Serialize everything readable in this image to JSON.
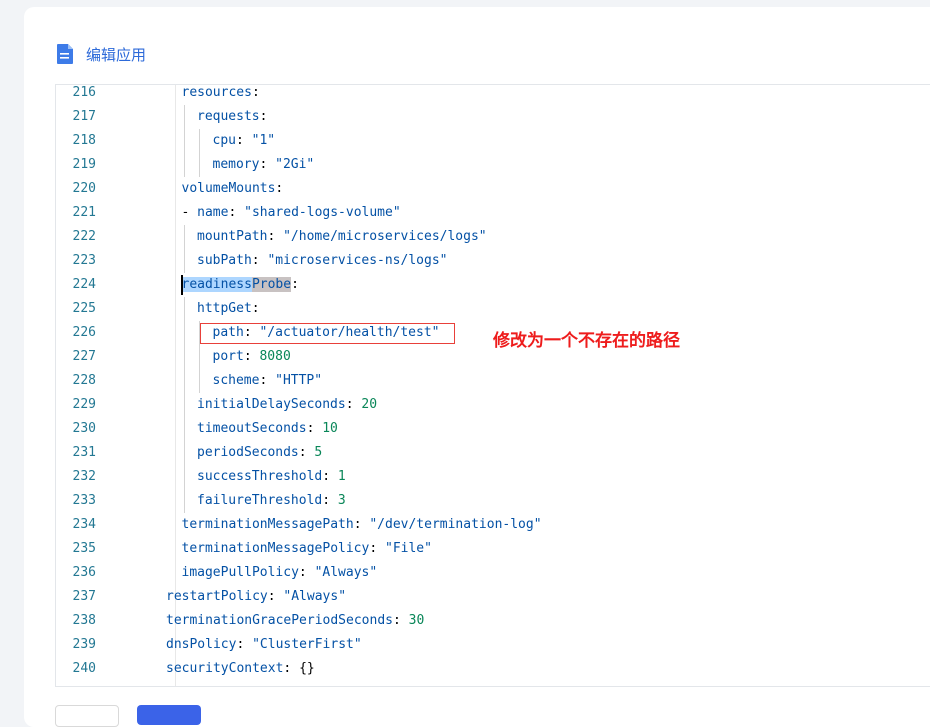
{
  "header": {
    "title": "编辑应用",
    "icon": "document-icon"
  },
  "annotation": {
    "text": "修改为一个不存在的路径",
    "color": "#ee1c1c"
  },
  "lines": [
    {
      "num": "216",
      "indent": 1,
      "parts": [
        {
          "t": "resources",
          "c": "k"
        },
        {
          "t": ":",
          "c": "p"
        }
      ]
    },
    {
      "num": "217",
      "indent": 2,
      "parts": [
        {
          "t": "requests",
          "c": "k"
        },
        {
          "t": ":",
          "c": "p"
        }
      ]
    },
    {
      "num": "218",
      "indent": 3,
      "parts": [
        {
          "t": "cpu",
          "c": "k"
        },
        {
          "t": ": ",
          "c": "p"
        },
        {
          "t": "\"1\"",
          "c": "s2"
        }
      ]
    },
    {
      "num": "219",
      "indent": 3,
      "parts": [
        {
          "t": "memory",
          "c": "k"
        },
        {
          "t": ": ",
          "c": "p"
        },
        {
          "t": "\"2Gi\"",
          "c": "s2"
        }
      ]
    },
    {
      "num": "220",
      "indent": 1,
      "parts": [
        {
          "t": "volumeMounts",
          "c": "k"
        },
        {
          "t": ":",
          "c": "p"
        }
      ]
    },
    {
      "num": "221",
      "indent": 1,
      "parts": [
        {
          "t": "- ",
          "c": "p"
        },
        {
          "t": "name",
          "c": "k"
        },
        {
          "t": ": ",
          "c": "p"
        },
        {
          "t": "\"shared-logs-volume\"",
          "c": "s2"
        }
      ]
    },
    {
      "num": "222",
      "indent": 2,
      "parts": [
        {
          "t": "mountPath",
          "c": "k"
        },
        {
          "t": ": ",
          "c": "p"
        },
        {
          "t": "\"/home/microservices/logs\"",
          "c": "s2"
        }
      ]
    },
    {
      "num": "223",
      "indent": 2,
      "parts": [
        {
          "t": "subPath",
          "c": "k"
        },
        {
          "t": ": ",
          "c": "p"
        },
        {
          "t": "\"microservices-ns/logs\"",
          "c": "s2"
        }
      ]
    },
    {
      "num": "224",
      "indent": 1,
      "parts": [
        {
          "t": "readiness",
          "c": "k sel1"
        },
        {
          "t": "Probe",
          "c": "k sel2"
        },
        {
          "t": ":",
          "c": "p"
        }
      ]
    },
    {
      "num": "225",
      "indent": 2,
      "parts": [
        {
          "t": "httpGet",
          "c": "k"
        },
        {
          "t": ":",
          "c": "p"
        }
      ]
    },
    {
      "num": "226",
      "indent": 3,
      "parts": [
        {
          "t": "path",
          "c": "k"
        },
        {
          "t": ": ",
          "c": "p"
        },
        {
          "t": "\"/actuator/health/test\"",
          "c": "s2"
        }
      ]
    },
    {
      "num": "227",
      "indent": 3,
      "parts": [
        {
          "t": "port",
          "c": "k"
        },
        {
          "t": ": ",
          "c": "p"
        },
        {
          "t": "8080",
          "c": "n"
        }
      ]
    },
    {
      "num": "228",
      "indent": 3,
      "parts": [
        {
          "t": "scheme",
          "c": "k"
        },
        {
          "t": ": ",
          "c": "p"
        },
        {
          "t": "\"HTTP\"",
          "c": "s2"
        }
      ]
    },
    {
      "num": "229",
      "indent": 2,
      "parts": [
        {
          "t": "initialDelaySeconds",
          "c": "k"
        },
        {
          "t": ": ",
          "c": "p"
        },
        {
          "t": "20",
          "c": "n"
        }
      ]
    },
    {
      "num": "230",
      "indent": 2,
      "parts": [
        {
          "t": "timeoutSeconds",
          "c": "k"
        },
        {
          "t": ": ",
          "c": "p"
        },
        {
          "t": "10",
          "c": "n"
        }
      ]
    },
    {
      "num": "231",
      "indent": 2,
      "parts": [
        {
          "t": "periodSeconds",
          "c": "k"
        },
        {
          "t": ": ",
          "c": "p"
        },
        {
          "t": "5",
          "c": "n"
        }
      ]
    },
    {
      "num": "232",
      "indent": 2,
      "parts": [
        {
          "t": "successThreshold",
          "c": "k"
        },
        {
          "t": ": ",
          "c": "p"
        },
        {
          "t": "1",
          "c": "n"
        }
      ]
    },
    {
      "num": "233",
      "indent": 2,
      "parts": [
        {
          "t": "failureThreshold",
          "c": "k"
        },
        {
          "t": ": ",
          "c": "p"
        },
        {
          "t": "3",
          "c": "n"
        }
      ]
    },
    {
      "num": "234",
      "indent": 1,
      "parts": [
        {
          "t": "terminationMessagePath",
          "c": "k"
        },
        {
          "t": ": ",
          "c": "p"
        },
        {
          "t": "\"/dev/termination-log\"",
          "c": "s2"
        }
      ]
    },
    {
      "num": "235",
      "indent": 1,
      "parts": [
        {
          "t": "terminationMessagePolicy",
          "c": "k"
        },
        {
          "t": ": ",
          "c": "p"
        },
        {
          "t": "\"File\"",
          "c": "s2"
        }
      ]
    },
    {
      "num": "236",
      "indent": 1,
      "parts": [
        {
          "t": "imagePullPolicy",
          "c": "k"
        },
        {
          "t": ": ",
          "c": "p"
        },
        {
          "t": "\"Always\"",
          "c": "s2"
        }
      ]
    },
    {
      "num": "237",
      "indent": 0,
      "parts": [
        {
          "t": "restartPolicy",
          "c": "k"
        },
        {
          "t": ": ",
          "c": "p"
        },
        {
          "t": "\"Always\"",
          "c": "s2"
        }
      ]
    },
    {
      "num": "238",
      "indent": 0,
      "parts": [
        {
          "t": "terminationGracePeriodSeconds",
          "c": "k"
        },
        {
          "t": ": ",
          "c": "p"
        },
        {
          "t": "30",
          "c": "n"
        }
      ]
    },
    {
      "num": "239",
      "indent": 0,
      "parts": [
        {
          "t": "dnsPolicy",
          "c": "k"
        },
        {
          "t": ": ",
          "c": "p"
        },
        {
          "t": "\"ClusterFirst\"",
          "c": "s2"
        }
      ]
    },
    {
      "num": "240",
      "indent": 0,
      "parts": [
        {
          "t": "securityContext",
          "c": "k"
        },
        {
          "t": ": ",
          "c": "p"
        },
        {
          "t": "{}",
          "c": "p"
        }
      ]
    }
  ]
}
